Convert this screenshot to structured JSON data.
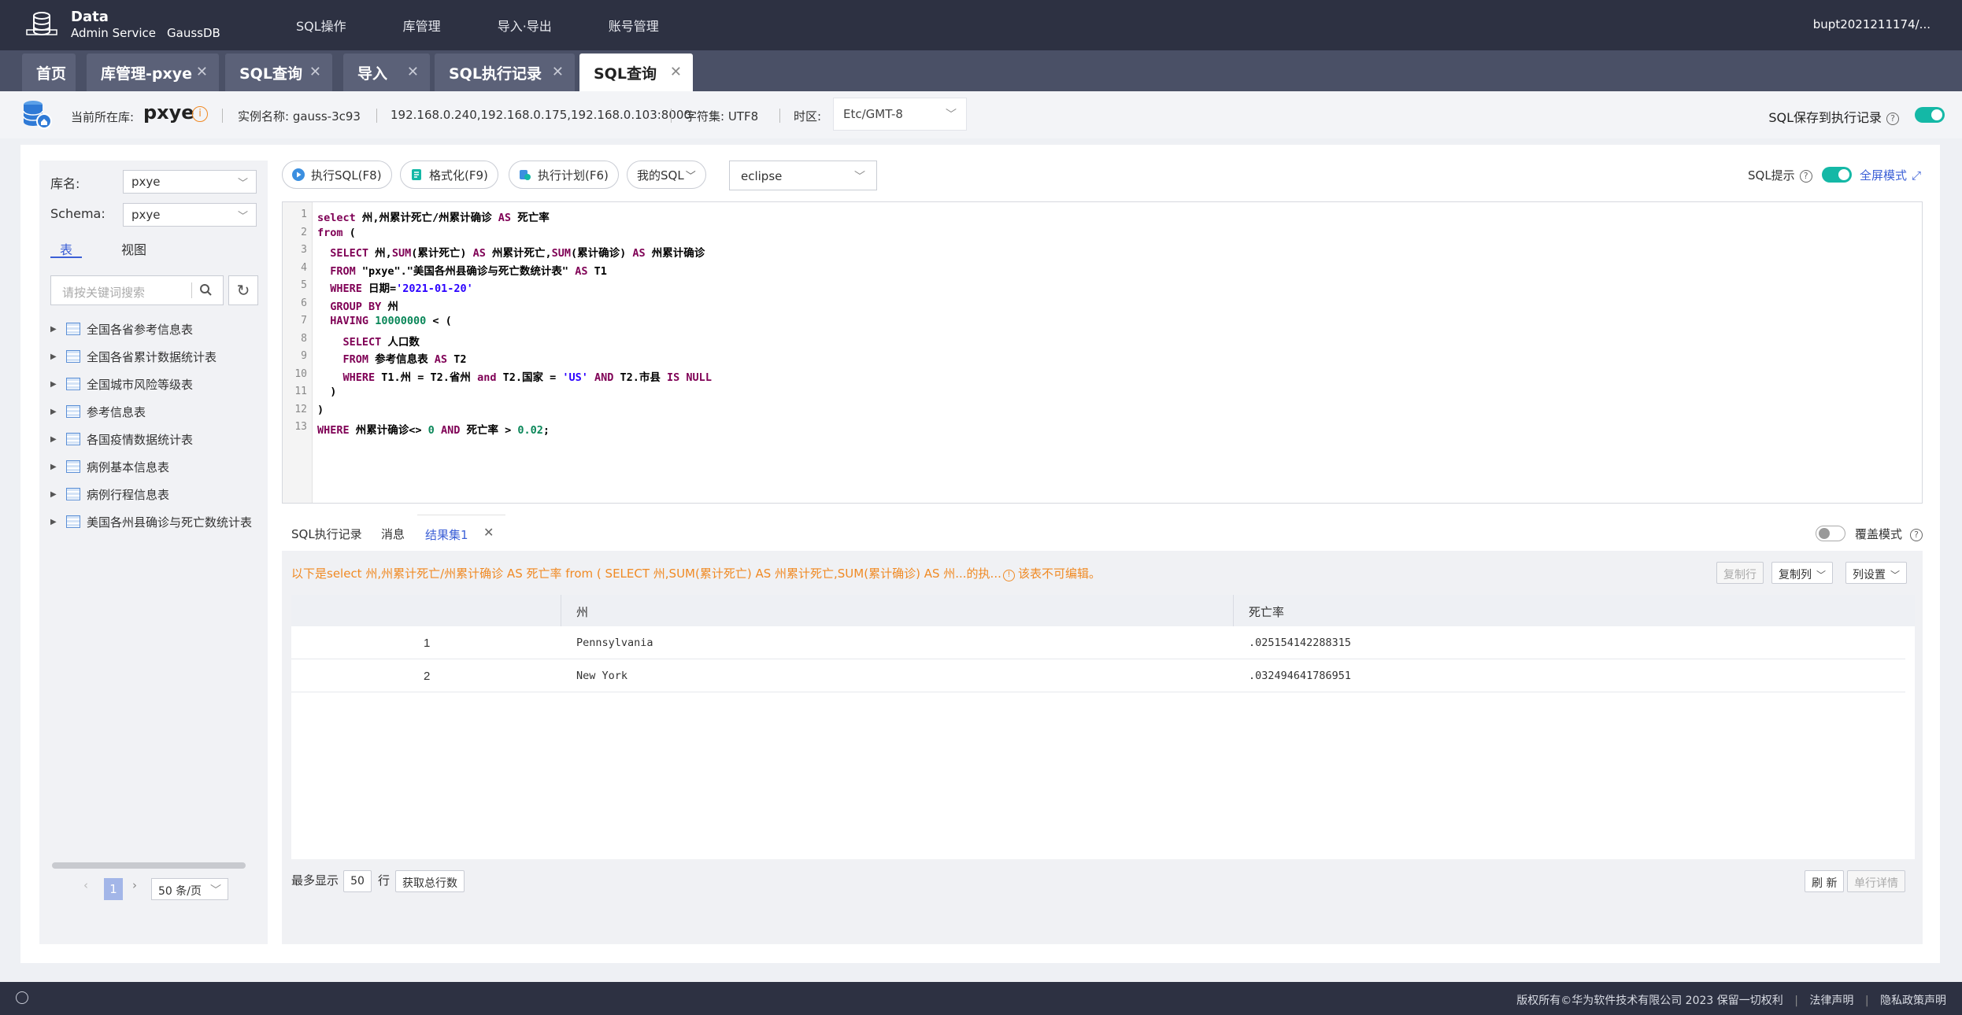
{
  "app": {
    "logo_line1": "Data",
    "logo_line2": "Admin Service",
    "logo_product": "GaussDB",
    "nav": [
      "SQL操作",
      "库管理",
      "导入·导出",
      "账号管理"
    ],
    "user": "bupt2021211174/..."
  },
  "tabs": [
    {
      "label": "首页"
    },
    {
      "label": "库管理-pxye"
    },
    {
      "label": "SQL查询"
    },
    {
      "label": "导入"
    },
    {
      "label": "SQL执行记录"
    },
    {
      "label": "SQL查询"
    }
  ],
  "info": {
    "current_db_label": "当前所在库:",
    "current_db": "pxye",
    "instance": "实例名称: gauss-3c93",
    "ips": "192.168.0.240,192.168.0.175,192.168.0.103:8000",
    "charset": "字符集: UTF8",
    "tz_label": "时区:",
    "tz_value": "Etc/GMT-8",
    "save_log": "SQL保存到执行记录"
  },
  "left": {
    "db_label": "库名:",
    "db_value": "pxye",
    "schema_label": "Schema:",
    "schema_value": "pxye",
    "tab_tables": "表",
    "tab_views": "视图",
    "search_placeholder": "请按关键词搜索",
    "tables": [
      "全国各省参考信息表",
      "全国各省累计数据统计表",
      "全国城市风险等级表",
      "参考信息表",
      "各国疫情数据统计表",
      "病例基本信息表",
      "病例行程信息表",
      "美国各州县确诊与死亡数统计表"
    ],
    "page": "1",
    "page_size": "50 条/页"
  },
  "toolbar": {
    "exec": "执行SQL(F8)",
    "format": "格式化(F9)",
    "plan": "执行计划(F6)",
    "my_sql": "我的SQL",
    "theme": "eclipse",
    "sql_tip": "SQL提示",
    "fullscreen": "全屏模式"
  },
  "editor": {
    "lines": [
      "1",
      "2",
      "3",
      "4",
      "5",
      "6",
      "7",
      "8",
      "9",
      "10",
      "11",
      "12",
      "13"
    ]
  },
  "result": {
    "tab_log": "SQL执行记录",
    "tab_msg": "消息",
    "tab_result": "结果集1",
    "overlay_mode": "覆盖模式",
    "message": "以下是select 州,州累计死亡/州累计确诊 AS 死亡率 from ( SELECT 州,SUM(累计死亡) AS 州累计死亡,SUM(累计确诊) AS 州...的执...",
    "warn": "该表不可编辑。",
    "copy_row": "复制行",
    "copy_col": "复制列",
    "col_settings": "列设置",
    "columns": [
      "州",
      "死亡率"
    ],
    "rows": [
      {
        "n": "1",
        "state": "Pennsylvania",
        "rate": ".025154142288315"
      },
      {
        "n": "2",
        "state": "New York",
        "rate": ".032494641786951"
      }
    ],
    "max_show": "最多显示",
    "max_value": "50",
    "row_unit": "行",
    "get_total": "获取总行数",
    "refresh": "刷 新",
    "row_detail": "单行详情"
  },
  "footer": {
    "copyright": "版权所有©华为软件技术有限公司 2023 保留一切权利",
    "legal": "法律声明",
    "privacy": "隐私政策声明"
  },
  "colors": {
    "header_bg": "#2d3142",
    "accent": "#3b5fd6",
    "toggle": "#14b8a6",
    "warning": "#f08a24"
  }
}
